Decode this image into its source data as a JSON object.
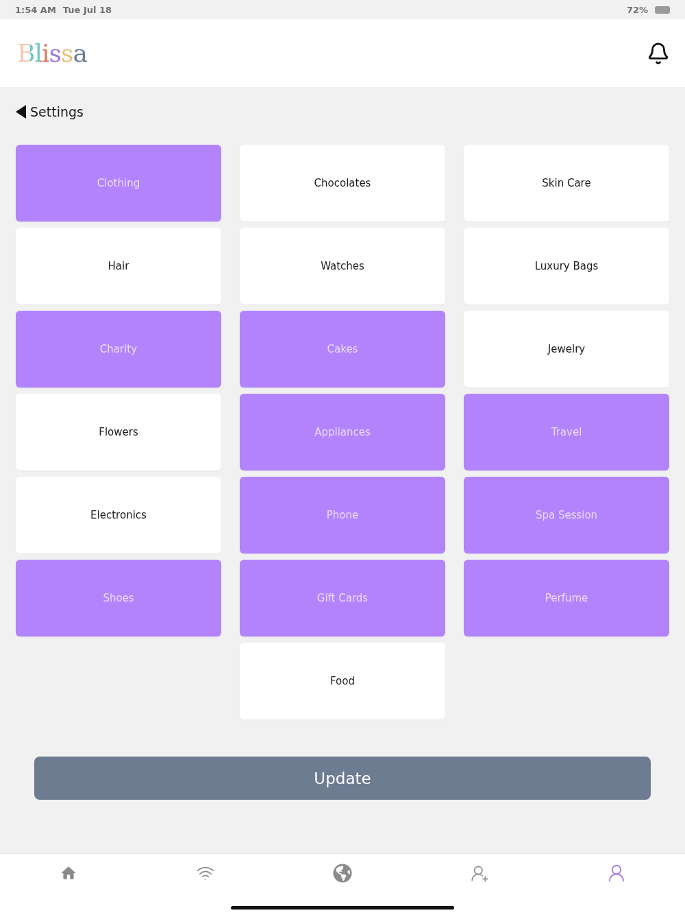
{
  "status_bar": {
    "time": "1:54 AM",
    "date": "Tue Jul 18",
    "battery": "72%"
  },
  "header": {
    "logo": "Blissa"
  },
  "back": {
    "label": "Settings"
  },
  "categories": [
    {
      "label": "Clothing",
      "selected": true
    },
    {
      "label": "Chocolates",
      "selected": false
    },
    {
      "label": "Skin Care",
      "selected": false
    },
    {
      "label": "Hair",
      "selected": false
    },
    {
      "label": "Watches",
      "selected": false
    },
    {
      "label": "Luxury Bags",
      "selected": false
    },
    {
      "label": "Charity",
      "selected": true
    },
    {
      "label": "Cakes",
      "selected": true
    },
    {
      "label": "Jewelry",
      "selected": false
    },
    {
      "label": "Flowers",
      "selected": false
    },
    {
      "label": "Appliances",
      "selected": true
    },
    {
      "label": "Travel",
      "selected": true
    },
    {
      "label": "Electronics",
      "selected": false
    },
    {
      "label": "Phone",
      "selected": true
    },
    {
      "label": "Spa Session",
      "selected": true
    },
    {
      "label": "Shoes",
      "selected": true
    },
    {
      "label": "Gift Cards",
      "selected": true
    },
    {
      "label": "Perfume",
      "selected": true
    },
    {
      "label": "Food",
      "selected": false
    }
  ],
  "update_button": {
    "label": "Update"
  },
  "nav": [
    {
      "kind": "home",
      "selected": false
    },
    {
      "kind": "wifi",
      "selected": false
    },
    {
      "kind": "globe",
      "selected": false
    },
    {
      "kind": "add-user",
      "selected": false
    },
    {
      "kind": "profile",
      "selected": true
    }
  ]
}
